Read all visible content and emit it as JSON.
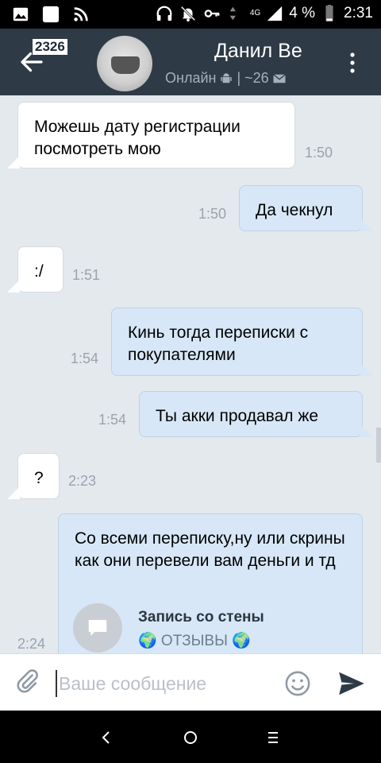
{
  "status_bar": {
    "icons_left": [
      "image-icon",
      "square-notification-icon",
      "rss-icon"
    ],
    "icons_right": [
      "headphones-icon",
      "mute-bell-icon",
      "key-icon",
      "signal-arrows-icon"
    ],
    "network": "4G",
    "battery_percent": "4 %",
    "time": "2:31"
  },
  "header": {
    "unread_count": "2326",
    "contact_name": "Данил Ве",
    "status_text": "Онлайн",
    "status_extra": "| ~26"
  },
  "messages": [
    {
      "direction": "in",
      "text": "Можешь дату регистрации посмотреть мою",
      "time": "1:50"
    },
    {
      "direction": "out",
      "text": "Да чекнул",
      "time": "1:50"
    },
    {
      "direction": "in",
      "text": ":/",
      "time": "1:51"
    },
    {
      "direction": "out",
      "text": "Кинь тогда переписки с покупателями",
      "time": "1:54"
    },
    {
      "direction": "out",
      "text": "Ты акки продавал же",
      "time": "1:54"
    },
    {
      "direction": "in",
      "text": "?",
      "time": "2:23"
    },
    {
      "direction": "out",
      "text": "Со всеми переписку,ну или скрины как они перевели вам деньги и тд",
      "time": "2:24",
      "attachment": {
        "title": "Запись со стены",
        "subtitle": "🌍 ОТЗЫВЫ 🌍"
      }
    }
  ],
  "composer": {
    "placeholder": "Ваше сообщение",
    "value": ""
  },
  "colors": {
    "header_bg": "#2e3a46",
    "chat_bg": "#e4e9ee",
    "incoming_bubble": "#ffffff",
    "outgoing_bubble": "#d7e7f7",
    "send_accent": "#2e3a46"
  }
}
